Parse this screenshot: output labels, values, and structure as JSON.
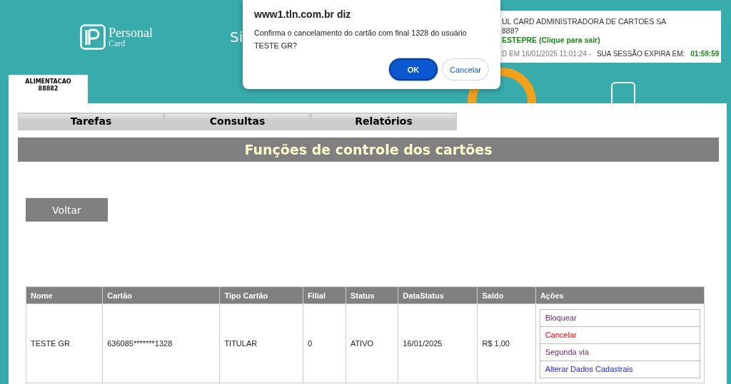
{
  "header": {
    "logo": {
      "line_1": "Personal",
      "line_2": "Card"
    },
    "title_fragment": "Si",
    "product_tab": {
      "name": "ALIMENTACAO",
      "code": "88882"
    },
    "session_box": {
      "company": "UL CARD ADMINISTRADORA DE CARTOES SA",
      "code": "888?",
      "user_link": "ESTEPRE (Clique para sair)",
      "login_time": "D EM 16/01/2025 11:01:24 -",
      "expiry_label": "SUA SESSÃO EXPIRA EM:",
      "expiry_value": "01:59:59"
    }
  },
  "dialog": {
    "title": "www1.tln.com.br diz",
    "message": "Confirma o cancelamento do cartão com final 1328 do usuário TESTE GR?",
    "buttons": [
      {
        "label": "OK",
        "kind": "primary"
      },
      {
        "label": "Cancelar",
        "kind": "secondary"
      }
    ]
  },
  "menu": [
    {
      "label": "Tarefas"
    },
    {
      "label": "Consultas"
    },
    {
      "label": "Relatórios"
    }
  ],
  "page_title": "Funções de controle dos cartões",
  "back_button": "Voltar",
  "table": {
    "columns": [
      "Nome",
      "Cartão",
      "Tipo Cartão",
      "Filial",
      "Status",
      "DataStatus",
      "Saldo",
      "Ações"
    ],
    "rows": [
      {
        "cells": [
          "TESTE GR",
          "636085*******1328",
          "TITULAR",
          "0",
          "ATIVO",
          "16/01/2025",
          "R$ 1,00"
        ],
        "actions": [
          {
            "label": "Bloquear",
            "kind": "visited"
          },
          {
            "label": "Cancelar",
            "kind": "danger"
          },
          {
            "label": "Segunda via",
            "kind": "visited"
          },
          {
            "label": "Alterar Dados Cadastrais",
            "kind": "link"
          }
        ]
      }
    ]
  }
}
